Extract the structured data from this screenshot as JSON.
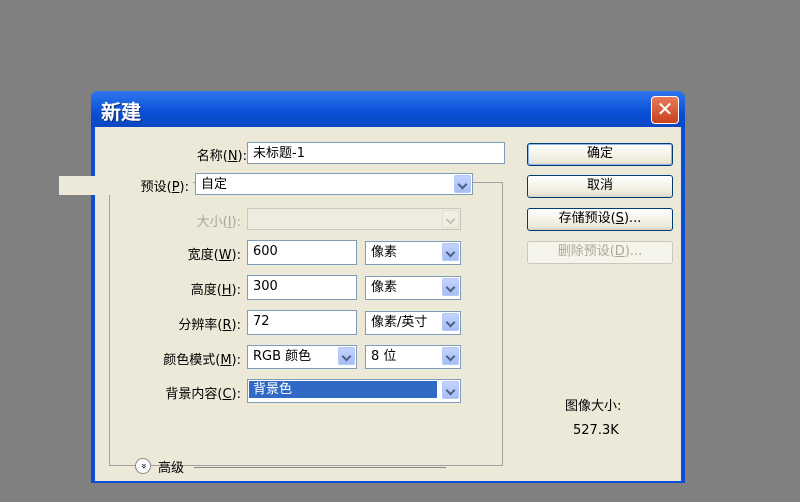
{
  "window": {
    "title": "新建",
    "close_glyph": "✕"
  },
  "form": {
    "name_label": "名称(",
    "name_key": "N",
    "name_label_end": "):",
    "name_value": "未标题-1",
    "preset_label": "预设(",
    "preset_key": "P",
    "preset_label_end": "):",
    "preset_value": "自定",
    "size_label": "大小(",
    "size_key": "I",
    "size_label_end": "):",
    "size_value": "",
    "width_label": "宽度(",
    "width_key": "W",
    "width_label_end": "):",
    "width_value": "600",
    "width_unit": "像素",
    "height_label": "高度(",
    "height_key": "H",
    "height_label_end": "):",
    "height_value": "300",
    "height_unit": "像素",
    "resolution_label": "分辨率(",
    "resolution_key": "R",
    "resolution_label_end": "):",
    "resolution_value": "72",
    "resolution_unit": "像素/英寸",
    "colormode_label": "颜色模式(",
    "colormode_key": "M",
    "colormode_label_end": "):",
    "colormode_value": "RGB 颜色",
    "bitdepth_value": "8 位",
    "bg_label": "背景内容(",
    "bg_key": "C",
    "bg_label_end": "):",
    "bg_value": "背景色",
    "advanced_label": "高级",
    "advanced_glyph": "»"
  },
  "buttons": {
    "ok": "确定",
    "cancel": "取消",
    "save_preset_a": "存储预设(",
    "save_preset_key": "S",
    "save_preset_b": ")...",
    "delete_preset_a": "删除预设(",
    "delete_preset_key": "D",
    "delete_preset_b": ")..."
  },
  "image_size": {
    "label": "图像大小:",
    "value": "527.3K"
  }
}
